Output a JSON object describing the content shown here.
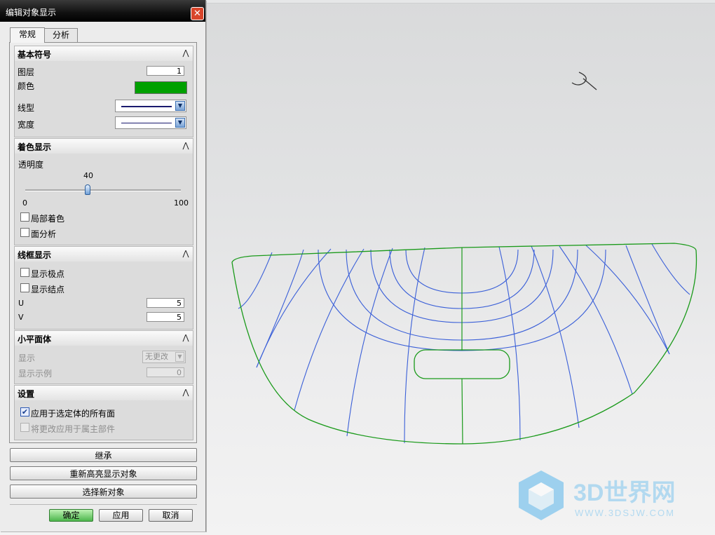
{
  "dialog": {
    "title": "编辑对象显示",
    "close_glyph": "✕",
    "tabs": [
      {
        "label": "常规"
      },
      {
        "label": "分析"
      }
    ],
    "sections": {
      "basic": {
        "title": "基本符号",
        "layer_label": "图层",
        "layer_value": "1",
        "color_label": "颜色",
        "color_value": "#00a000",
        "linetype_label": "线型",
        "width_label": "宽度"
      },
      "shading": {
        "title": "着色显示",
        "transparency_label": "透明度",
        "slider_value": "40",
        "slider_value_num": 40,
        "slider_min": "0",
        "slider_max": "100",
        "local_shading_label": "局部着色",
        "local_shading_checked": false,
        "face_analysis_label": "面分析",
        "face_analysis_checked": false
      },
      "wireframe": {
        "title": "线框显示",
        "show_poles_label": "显示极点",
        "show_poles_checked": false,
        "show_knots_label": "显示结点",
        "show_knots_checked": false,
        "u_label": "U",
        "u_value": "5",
        "v_label": "V",
        "v_value": "5"
      },
      "facets": {
        "title": "小平面体",
        "display_label": "显示",
        "display_value": "无更改",
        "example_label": "显示示例",
        "example_value": "0"
      },
      "settings": {
        "title": "设置",
        "apply_all_label": "应用于选定体的所有面",
        "apply_all_checked": true,
        "apply_owner_label": "将更改应用于属主部件",
        "apply_owner_checked": false
      }
    },
    "buttons": {
      "inherit": "继承",
      "rehighlight": "重新高亮显示对象",
      "select_new": "选择新对象",
      "ok": "确定",
      "apply": "应用",
      "cancel": "取消"
    },
    "collapse_glyph": "⋀"
  },
  "viewport": {
    "wire_color": "#3a5fd8",
    "boundary_color": "#1a9a1a",
    "watermark_text": "3D世界网",
    "watermark_url": "WWW.3DSJW.COM"
  }
}
